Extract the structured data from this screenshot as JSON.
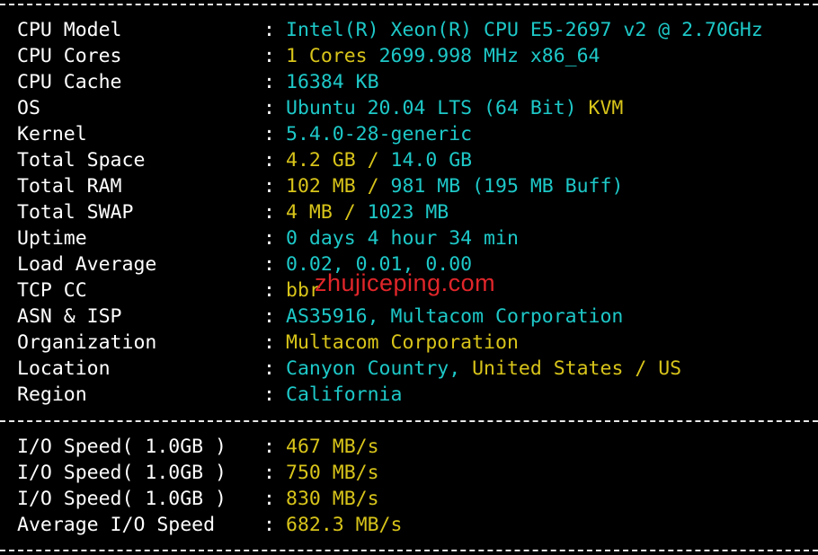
{
  "info_rows": [
    {
      "label": "CPU Model",
      "segments": [
        {
          "text": "Intel(R) Xeon(R) CPU E5-2697 v2 @ 2.70GHz",
          "color": "cyan"
        }
      ]
    },
    {
      "label": "CPU Cores",
      "segments": [
        {
          "text": "1 Cores ",
          "color": "yellow"
        },
        {
          "text": "2699.998 MHz x86_64",
          "color": "cyan"
        }
      ]
    },
    {
      "label": "CPU Cache",
      "segments": [
        {
          "text": "16384 KB",
          "color": "cyan"
        }
      ]
    },
    {
      "label": "OS",
      "segments": [
        {
          "text": "Ubuntu 20.04 LTS (64 Bit) ",
          "color": "cyan"
        },
        {
          "text": "KVM",
          "color": "yellow"
        }
      ]
    },
    {
      "label": "Kernel",
      "segments": [
        {
          "text": "5.4.0-28-generic",
          "color": "cyan"
        }
      ]
    },
    {
      "label": "Total Space",
      "segments": [
        {
          "text": "4.2 GB / ",
          "color": "yellow"
        },
        {
          "text": "14.0 GB",
          "color": "cyan"
        }
      ]
    },
    {
      "label": "Total RAM",
      "segments": [
        {
          "text": "102 MB / ",
          "color": "yellow"
        },
        {
          "text": "981 MB (195 MB Buff)",
          "color": "cyan"
        }
      ]
    },
    {
      "label": "Total SWAP",
      "segments": [
        {
          "text": "4 MB / ",
          "color": "yellow"
        },
        {
          "text": "1023 MB",
          "color": "cyan"
        }
      ]
    },
    {
      "label": "Uptime",
      "segments": [
        {
          "text": "0 days 4 hour 34 min",
          "color": "cyan"
        }
      ]
    },
    {
      "label": "Load Average",
      "segments": [
        {
          "text": "0.02, 0.01, 0.00",
          "color": "cyan"
        }
      ]
    },
    {
      "label": "TCP CC",
      "segments": [
        {
          "text": "bbr",
          "color": "yellow"
        }
      ]
    },
    {
      "label": "ASN & ISP",
      "segments": [
        {
          "text": "AS35916, Multacom Corporation",
          "color": "cyan"
        }
      ]
    },
    {
      "label": "Organization",
      "segments": [
        {
          "text": "Multacom Corporation",
          "color": "yellow"
        }
      ]
    },
    {
      "label": "Location",
      "segments": [
        {
          "text": "Canyon Country, ",
          "color": "cyan"
        },
        {
          "text": "United States / US",
          "color": "yellow"
        }
      ]
    },
    {
      "label": "Region",
      "segments": [
        {
          "text": "California",
          "color": "cyan"
        }
      ]
    }
  ],
  "io_rows": [
    {
      "label": "I/O Speed( 1.0GB )",
      "segments": [
        {
          "text": "467 MB/s",
          "color": "yellow"
        }
      ]
    },
    {
      "label": "I/O Speed( 1.0GB )",
      "segments": [
        {
          "text": "750 MB/s",
          "color": "yellow"
        }
      ]
    },
    {
      "label": "I/O Speed( 1.0GB )",
      "segments": [
        {
          "text": "830 MB/s",
          "color": "yellow"
        }
      ]
    },
    {
      "label": "Average I/O Speed",
      "segments": [
        {
          "text": "682.3 MB/s",
          "color": "yellow"
        }
      ]
    }
  ],
  "separator": ":",
  "watermark": "zhujiceping.com",
  "colors": {
    "background": "#000000",
    "label": "#ffffff",
    "cyan": "#1ec8c8",
    "yellow": "#d8c41a",
    "watermark": "#e0262a",
    "divider": "#e8e8e8"
  }
}
